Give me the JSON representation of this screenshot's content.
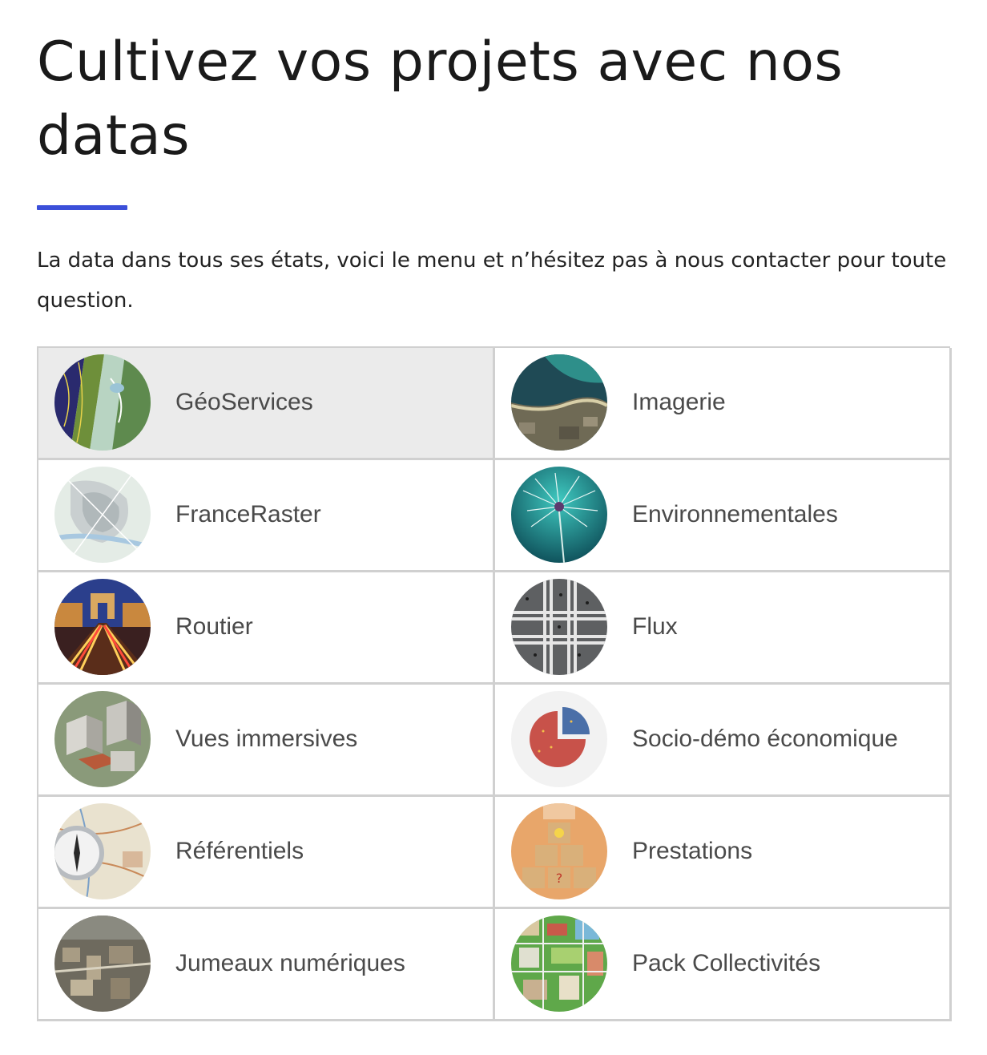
{
  "header": {
    "title": "Cultivez vos projets avec nos datas",
    "intro": "La data dans tous ses états, voici le menu et n’hésitez pas à nous contacter pour toute question."
  },
  "colors": {
    "accent": "#3b4fd9",
    "card_active_bg": "#ebebeb",
    "card_border": "#d0d0d0"
  },
  "categories": [
    {
      "label": "GéoServices",
      "icon": "map-layers-thumbnail",
      "active": true
    },
    {
      "label": "Imagerie",
      "icon": "aerial-coast-thumbnail",
      "active": false
    },
    {
      "label": "FranceRaster",
      "icon": "raster-map-thumbnail",
      "active": false
    },
    {
      "label": "Environnementales",
      "icon": "dandelion-thumbnail",
      "active": false
    },
    {
      "label": "Routier",
      "icon": "arc-de-triomphe-traffic-thumbnail",
      "active": false
    },
    {
      "label": "Flux",
      "icon": "crosswalk-crowd-thumbnail",
      "active": false
    },
    {
      "label": "Vues immersives",
      "icon": "3d-city-thumbnail",
      "active": false
    },
    {
      "label": "Socio-démo économique",
      "icon": "crowd-pie-chart-thumbnail",
      "active": false
    },
    {
      "label": "Référentiels",
      "icon": "compass-map-thumbnail",
      "active": false
    },
    {
      "label": "Prestations",
      "icon": "wooden-cubes-thumbnail",
      "active": false
    },
    {
      "label": "Jumeaux numériques",
      "icon": "3d-aerial-city-thumbnail",
      "active": false
    },
    {
      "label": "Pack Collectivités",
      "icon": "city-planning-thumbnail",
      "active": false
    }
  ]
}
